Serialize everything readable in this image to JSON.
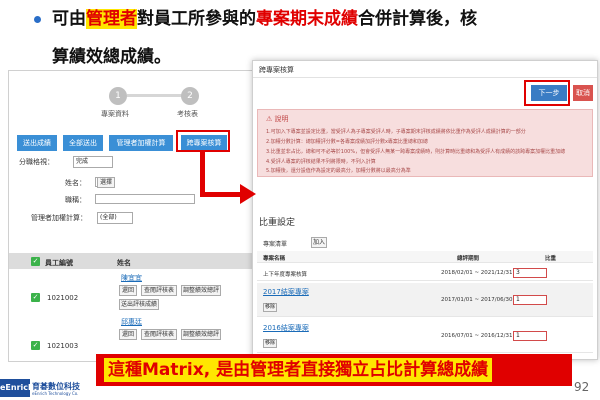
{
  "slide": {
    "heading_pre": "可由",
    "heading_hl": "管理者",
    "heading_mid": "對員工所參與的",
    "heading_red": "專案期末成績",
    "heading_post": "合併計算後，核",
    "heading_line2": "算績效總成績。",
    "banner": "這種Matrix, 是由管理者直接獨立占比計算總成績",
    "page_number": "92"
  },
  "left_panel": {
    "steps": [
      {
        "num": "1",
        "label": "專案資料"
      },
      {
        "num": "2",
        "label": "考核表"
      }
    ],
    "buttons": [
      "送出成績",
      "全部送出",
      "管理者加權計算",
      "跨專案核算"
    ],
    "filter_label": "分職格視：",
    "filter_value": "完成",
    "name_label": "姓名：",
    "name_btn": "選擇",
    "job_label": "職稱：",
    "weight_label": "管理者加權計算：",
    "weight_value": "(全部)",
    "col_employee": "員工編號",
    "col_name": "姓名",
    "rows": [
      {
        "id": "1021002",
        "name": "陳宜宜",
        "actions": [
          "還回",
          "查閱評核表",
          "調整績效總評"
        ],
        "extra": "送出評核成績"
      },
      {
        "id": "1021003",
        "name": "邱惠廷",
        "actions": [
          "還回",
          "查閱評核表",
          "調整績效總評"
        ]
      }
    ]
  },
  "right_panel": {
    "title": "跨專案核算",
    "next_label": "下一步",
    "cancel_label": "取消",
    "note_title": "說明",
    "notes": [
      "1.可加入下專案並設定比重，當受評人為子專案受評人時，子專案期末評核成績將依比重作為受評人成績計算的一部分",
      "2.加權分數計算：總加權評分數=各專案成績加評分數x專案比重總和加總",
      "3.比重並非占比，總和可不必等於100%，但會受評人無某一跨專案成績時，則計算時比重總和為受評人有成績的該跨專案加權比重加總",
      "4.受評人專案的評核結果不列將限時，不列入計算",
      "5.加權後，還分設值作為設定的最高分，加權分數將以最高分為準"
    ],
    "section_title": "比重設定",
    "project_list_label": "專案清單",
    "add_btn": "加入",
    "col_project": "專案名稱",
    "col_period": "總評期間",
    "col_ratio": "比重",
    "projects": [
      {
        "name": "上下年度專案核算",
        "period": "2018/02/01 ~ 2021/12/31",
        "ratio": "3",
        "link": false
      },
      {
        "name": "2017結案專案",
        "period": "2017/01/01 ~ 2017/06/30",
        "ratio": "1",
        "link": true,
        "btn": "移除"
      },
      {
        "name": "2016結案專案",
        "period": "2016/07/01 ~ 2016/12/31",
        "ratio": "1",
        "link": true,
        "btn": "移除"
      }
    ]
  },
  "footer": {
    "logo": "eEnrich",
    "company": "育碁數位科技",
    "company_en": "eEnrich Technology Co."
  },
  "colors": {
    "accent_red": "#e00000",
    "highlight_yellow": "#ffe600",
    "button_blue": "#3a8fd6",
    "brand_blue": "#1f4f9c"
  }
}
